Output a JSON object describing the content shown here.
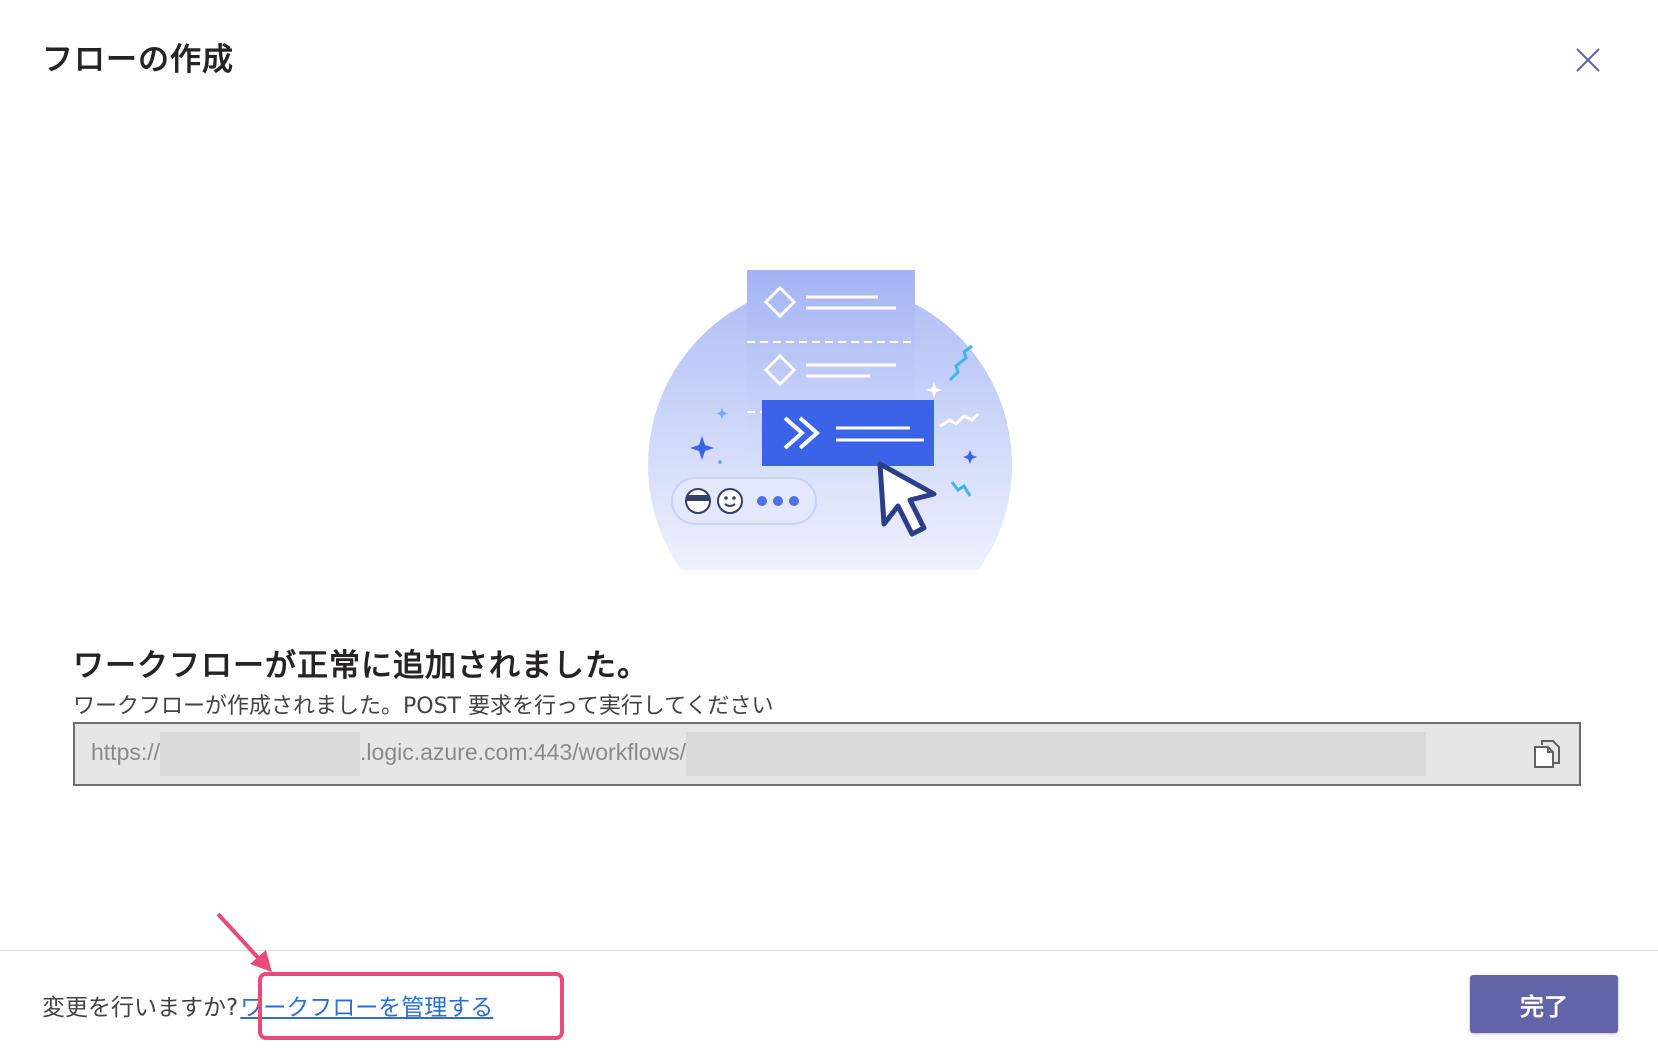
{
  "dialog": {
    "title": "フローの作成",
    "close_icon": "close-icon"
  },
  "success": {
    "heading": "ワークフローが正常に追加されました。",
    "description": "ワークフローが作成されました。POST 要求を行って実行してください",
    "url_prefix": "https://",
    "url_middle": ".logic.azure.com:443/workflows/",
    "url_suffix_fragment": "",
    "copy_icon": "copy-icon"
  },
  "footer": {
    "prompt": "変更を行いますか?",
    "manage_link": "ワークフローを管理する",
    "done_label": "完了"
  },
  "colors": {
    "accent": "#6264a7",
    "link": "#2b6fd6",
    "annotation": "#e84a7a"
  }
}
